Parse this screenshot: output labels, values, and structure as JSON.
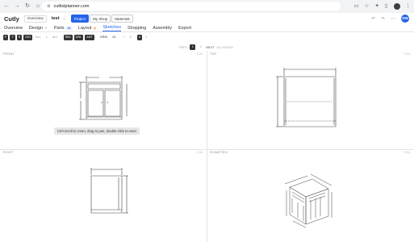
{
  "browser": {
    "url": "cutlistplanner.com"
  },
  "header": {
    "brand": "Cutly",
    "overview_label": "Overview",
    "project_name": "test",
    "tabs": [
      {
        "label": "Project"
      },
      {
        "label": "My Shop"
      },
      {
        "label": "Materials"
      }
    ],
    "avatar_initials": "DW"
  },
  "main_nav": {
    "items": [
      {
        "label": "Overview"
      },
      {
        "label": "Design"
      },
      {
        "label": "Parts",
        "badge": "16"
      },
      {
        "label": "Layout"
      },
      {
        "label": "Sketches"
      },
      {
        "label": "Shopping"
      },
      {
        "label": "Assembly"
      },
      {
        "label": "Export"
      }
    ]
  },
  "toolbar": {
    "buttons_a": [
      "F",
      "T",
      "R",
      "ISO"
    ],
    "buttons_a_faint": [
      "ALL",
      "L",
      "ALL"
    ],
    "units": [
      "IRM",
      "URL",
      "ANT"
    ],
    "grid_label": "GRID",
    "select_value": "24",
    "zoom_value": "8"
  },
  "pager": {
    "prev": "PREV",
    "pages": [
      "1",
      "2"
    ],
    "next": "NEXT",
    "extra": "ALL PAGES"
  },
  "panels": {
    "front": {
      "label": "FRONT",
      "full": "FULL"
    },
    "top": {
      "label": "TOP",
      "full": "FULL"
    },
    "right": {
      "label": "RIGHT",
      "full": "FULL"
    },
    "isometric": {
      "label": "ISOMETRIC",
      "full": "FULL"
    }
  },
  "tooltip": "Ctrl+scroll to zoom, drag to pan, double-click to reset",
  "colors": {
    "accent": "#2563eb",
    "dark_button": "#333333",
    "divider": "#e3e3e3"
  }
}
